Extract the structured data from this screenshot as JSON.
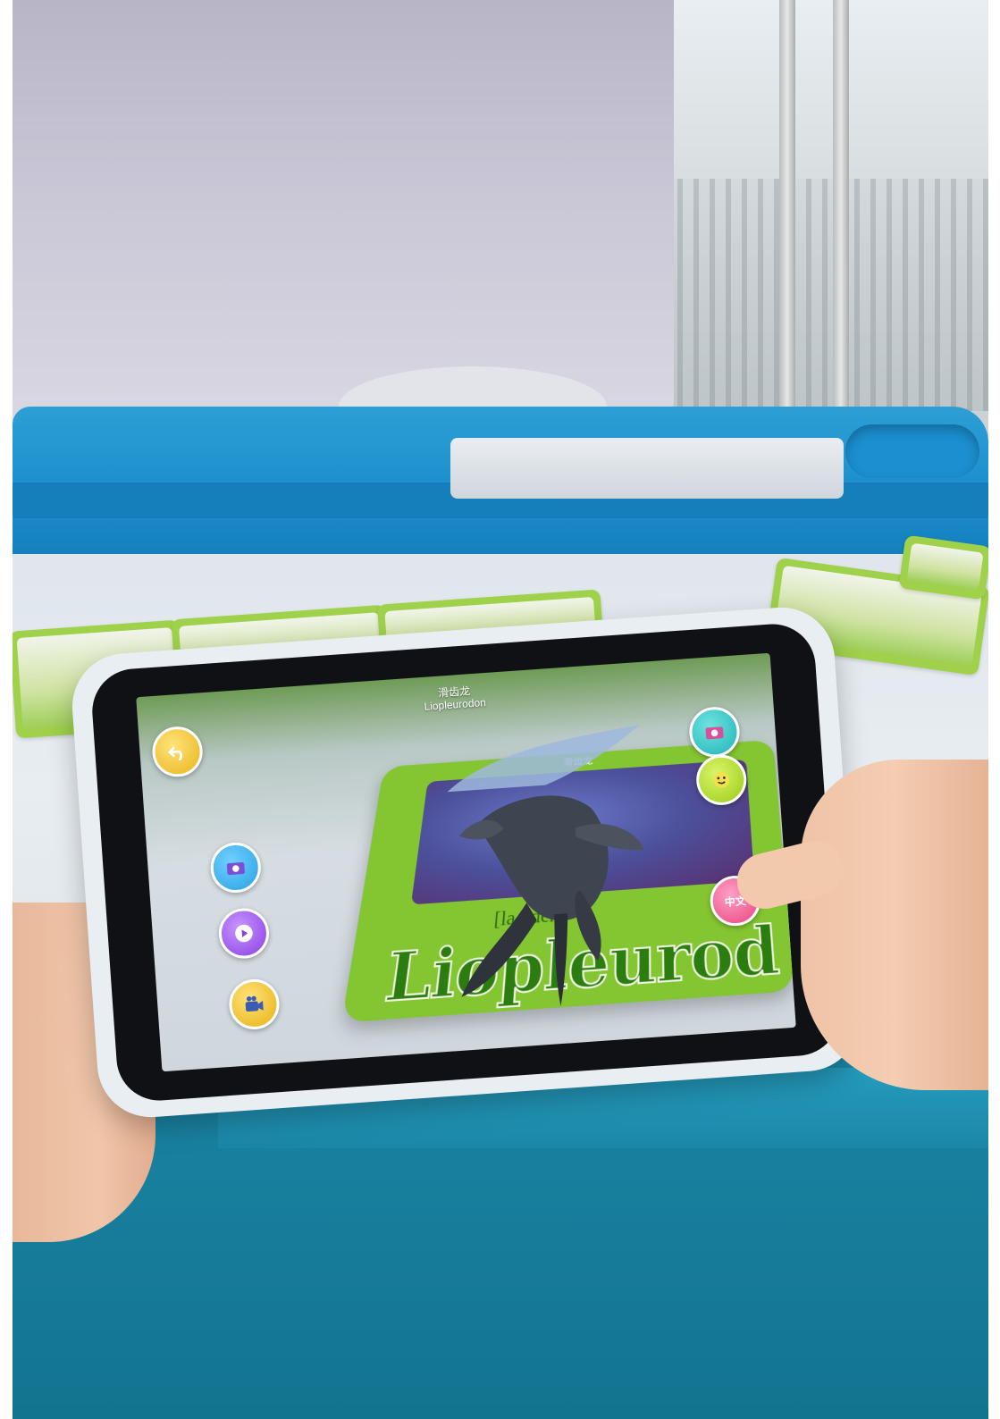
{
  "app": {
    "title_cn": "滑齿龙",
    "title_en": "Liopleurodon"
  },
  "ar_card": {
    "label": "滑齿龙",
    "phonetic": "[la   uden]",
    "name_partial": "Liopleurod"
  },
  "buttons": {
    "back_icon": "back-arrow-icon",
    "camera_icon": "camera-icon",
    "play_icon": "play-icon",
    "video_icon": "video-camera-icon",
    "camera2_icon": "camera-icon",
    "face_icon": "smiley-face-icon",
    "lang_label": "中文"
  },
  "colors": {
    "tray_blue": "#1a8ccb",
    "lid_teal": "#18809f",
    "card_green": "#84c532"
  }
}
